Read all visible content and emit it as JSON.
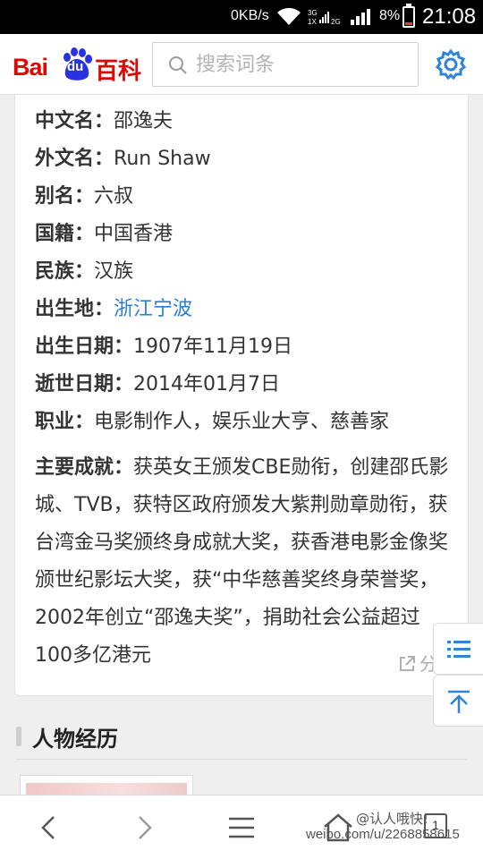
{
  "status_bar": {
    "network_speed": "0KB/s",
    "network_type_top": "3G",
    "network_type_bottom": "1X",
    "network_2g": "2G",
    "battery": "8%",
    "time": "21:08"
  },
  "header": {
    "logo_bai": "Bai",
    "logo_du": "du",
    "logo_baike": "百科",
    "search_placeholder": "搜索词条",
    "settings_icon": "gear-icon"
  },
  "info": {
    "rows": [
      {
        "key": "中文名：",
        "value": "邵逸夫"
      },
      {
        "key": "外文名：",
        "value": "Run Shaw"
      },
      {
        "key": "别名：",
        "value": "六叔"
      },
      {
        "key": "国籍：",
        "value": "中国香港"
      },
      {
        "key": "民族：",
        "value": "汉族"
      },
      {
        "key": "出生地：",
        "value": "浙江宁波",
        "link": true
      },
      {
        "key": "出生日期：",
        "value": "1907年11月19日"
      },
      {
        "key": "逝世日期：",
        "value": "2014年01月7日"
      },
      {
        "key": "职业：",
        "value": "电影制作人，娱乐业大亨、慈善家"
      }
    ],
    "achievement_key": "主要成就：",
    "achievement_value": "获英女王颁发CBE勋衔，创建邵氏影城、TVB，获特区政府颁发大紫荆勋章勋衔，获台湾金马奖颁终身成就大奖，获香港电影金像奖颁世纪影坛大奖，获“中华慈善奖终身荣誉奖，2002年创立“邵逸夫奖”，捐助社会公益超过100多亿港元",
    "share_label": "分享"
  },
  "section": {
    "title": "人物经历"
  },
  "floating": {
    "toc_icon": "list-icon",
    "top_icon": "back-to-top-icon"
  },
  "bottom_nav": {
    "tab_count": "1"
  },
  "watermark": {
    "handle": "@认人哦快!",
    "url": "weibo.com/u/2268858615"
  },
  "colors": {
    "brand_red": "#e10601",
    "brand_blue": "#2932e1",
    "link": "#2d7fd3",
    "accent": "#2d84d8"
  }
}
